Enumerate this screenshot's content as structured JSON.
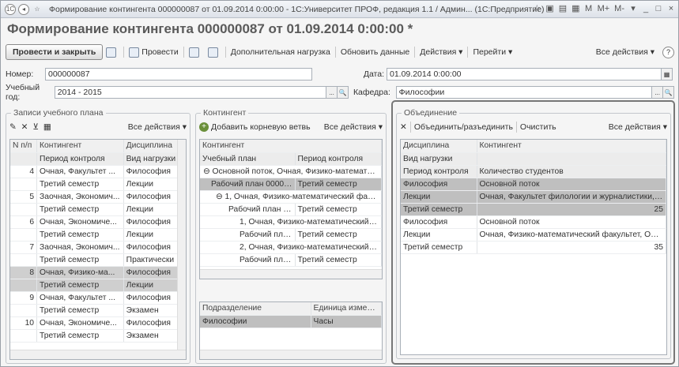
{
  "window": {
    "title": "Формирование контингента 000000087 от 01.09.2014 0:00:00 - 1С:Университет ПРОФ, редакция 1.1 / Админ... (1С:Предприятие)",
    "controls": [
      "☆",
      "▣",
      "▤",
      "▦",
      "M",
      "M+",
      "M-",
      "▾",
      "_",
      "□",
      "×"
    ]
  },
  "header": {
    "title": "Формирование контингента 000000087 от 01.09.2014 0:00:00 *"
  },
  "toolbar": {
    "post_close": "Провести и закрыть",
    "post": "Провести",
    "extra_load": "Дополнительная нагрузка",
    "refresh": "Обновить данные",
    "actions": "Действия ▾",
    "goto": "Перейти ▾",
    "all_actions": "Все действия ▾",
    "help": "?"
  },
  "form": {
    "number_label": "Номер:",
    "number_value": "000000087",
    "date_label": "Дата:",
    "date_value": "01.09.2014  0:00:00",
    "year_label": "Учебный год:",
    "year_value": "2014 - 2015",
    "dept_label": "Кафедра:",
    "dept_value": "Философии"
  },
  "plan": {
    "title": "Записи учебного плана",
    "all_actions": "Все действия ▾",
    "columns": [
      "N п/п",
      "Контингент",
      "Дисциплина"
    ],
    "subcolumns": [
      "",
      "Период контроля",
      "Вид нагрузки"
    ],
    "rows": [
      {
        "n": "4",
        "c": "Очная, Факультет ...",
        "d": "Философия",
        "p": "Третий семестр",
        "v": "Лекции"
      },
      {
        "n": "5",
        "c": "Заочная, Экономич...",
        "d": "Философия",
        "p": "Третий семестр",
        "v": "Лекции"
      },
      {
        "n": "6",
        "c": "Очная, Экономиче...",
        "d": "Философия",
        "p": "Третий семестр",
        "v": "Лекции"
      },
      {
        "n": "7",
        "c": "Заочная, Экономич...",
        "d": "Философия",
        "p": "Третий семестр",
        "v": "Практически"
      },
      {
        "n": "8",
        "c": "Очная, Физико-ма...",
        "d": "Философия",
        "p": "Третий семестр",
        "v": "Лекции"
      },
      {
        "n": "9",
        "c": "Очная, Факультет ...",
        "d": "Философия",
        "p": "Третий семестр",
        "v": "Экзамен"
      },
      {
        "n": "10",
        "c": "Очная, Экономиче...",
        "d": "Философия",
        "p": "Третий семестр",
        "v": "Экзамен"
      }
    ]
  },
  "contingent": {
    "title": "Контингент",
    "add_root": "Добавить корневую ветвь",
    "all_actions": "Все действия ▾",
    "col1": "Контингент",
    "col_plan": "Учебный план",
    "col_period": "Период контроля",
    "tree": [
      {
        "a": "⊖  Основной поток, Очная, Физико-математически",
        "b": ""
      },
      {
        "a": "Рабочий план 000000...",
        "b": "Третий семестр"
      },
      {
        "a": "⊖  1, Очная, Физико-математический факульте",
        "b": ""
      },
      {
        "a": "Рабочий план 000...",
        "b": "Третий семестр"
      },
      {
        "a": "1, Очная, Физико-математический факул",
        "b": ""
      },
      {
        "a": "Рабочий план ...",
        "b": "Третий семестр"
      },
      {
        "a": "2, Очная, Физико-математический факул",
        "b": ""
      },
      {
        "a": "Рабочий план ...",
        "b": "Третий семестр"
      }
    ],
    "units_cols": [
      "Подразделение",
      "Единица измерени"
    ],
    "units_row": [
      "Философии",
      "Часы"
    ]
  },
  "merge": {
    "title": "Объединение",
    "merge_btn": "Объединить/разъединить",
    "clear_btn": "Очистить",
    "all_actions": "Все действия ▾",
    "cols": [
      "Дисциплина",
      "Контингент"
    ],
    "sub1": "Вид нагрузки",
    "sub2a": "Период контроля",
    "sub2b": "Количество студентов",
    "groups": [
      {
        "d": "Философия",
        "c": "Основной поток",
        "v": "Лекции",
        "vc": "Очная, Факультет филологии и журналистики, Фил...",
        "p": "Третий семестр",
        "n": "25"
      },
      {
        "d": "Философия",
        "c": "Основной поток",
        "v": "Лекции",
        "vc": "Очная, Физико-математический факультет, Органи...",
        "p": "Третий семестр",
        "n": "35"
      }
    ]
  }
}
